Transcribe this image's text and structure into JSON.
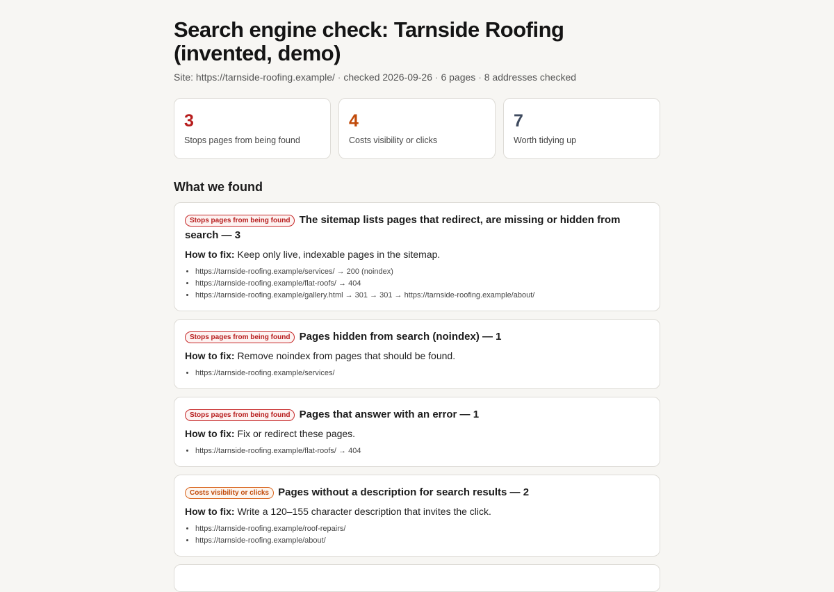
{
  "header": {
    "title": "Search engine check: Tarnside Roofing (invented, demo)",
    "site": "Site: https://tarnside-roofing.example/",
    "checked": "checked 2026-09-26",
    "pages": "6 pages",
    "addresses": "8 addresses checked",
    "separator": "·"
  },
  "summary": [
    {
      "count": "3",
      "label": "Stops pages from being found",
      "color": "#b71c1c"
    },
    {
      "count": "4",
      "label": "Costs visibility or clicks",
      "color": "#c14a09"
    },
    {
      "count": "7",
      "label": "Worth tidying up",
      "color": "#3f4b5f"
    }
  ],
  "section_title": "What we found",
  "fix_prefix": "How to fix:",
  "findings": [
    {
      "badge": "Stops pages from being found",
      "title": "The sitemap lists pages that redirect, are missing or hidden from search — 3",
      "fix": "Keep only live, indexable pages in the sitemap.",
      "urls": [
        "https://tarnside-roofing.example/services/ → 200 (noindex)",
        "https://tarnside-roofing.example/flat-roofs/ → 404",
        "https://tarnside-roofing.example/gallery.html → 301 → 301 → https://tarnside-roofing.example/about/"
      ]
    },
    {
      "badge": "Stops pages from being found",
      "title": "Pages hidden from search (noindex) — 1",
      "fix": "Remove noindex from pages that should be found.",
      "urls": [
        "https://tarnside-roofing.example/services/"
      ]
    },
    {
      "badge": "Stops pages from being found",
      "title": "Pages that answer with an error — 1",
      "fix": "Fix or redirect these pages.",
      "urls": [
        "https://tarnside-roofing.example/flat-roofs/ → 404"
      ]
    },
    {
      "badge": "Costs visibility or clicks",
      "title": "Pages without a description for search results — 2",
      "fix": "Write a 120–155 character description that invites the click.",
      "urls": [
        "https://tarnside-roofing.example/roof-repairs/",
        "https://tarnside-roofing.example/about/"
      ]
    }
  ],
  "colors": {
    "critical": "#b71c1c",
    "warning": "#c14a09",
    "minor": "#3f4b5f",
    "background": "#f7f6f3"
  }
}
